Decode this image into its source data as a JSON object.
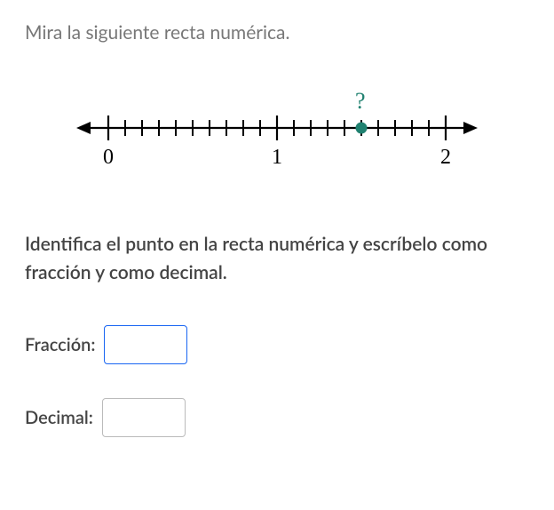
{
  "intro_text": "Mira la siguiente recta numérica.",
  "instructions_text": "Identifica el punto en la recta numérica y escríbelo como fracción y como decimal.",
  "fraction_label": "Fracción:",
  "decimal_label": "Decimal:",
  "question_mark": "?",
  "fraction_value": "",
  "decimal_value": "",
  "chart_data": {
    "type": "number_line",
    "range": [
      0,
      2
    ],
    "major_ticks": [
      0,
      1,
      2
    ],
    "minor_tick_interval": 0.1,
    "marked_point": 1.5,
    "tick_labels": [
      "0",
      "1",
      "2"
    ],
    "marker_color": "#208170",
    "axis_color": "#000000"
  }
}
